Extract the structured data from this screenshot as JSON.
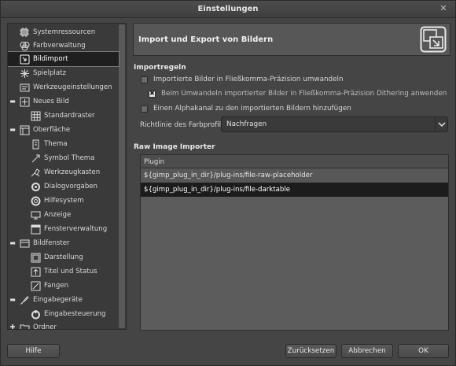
{
  "window": {
    "title": "Einstellungen",
    "close_glyph": "✕"
  },
  "sidebar": {
    "items": [
      {
        "label": "Systemressourcen",
        "icon": "chip-icon"
      },
      {
        "label": "Farbverwaltung",
        "icon": "color-management-icon"
      },
      {
        "label": "Bildimport",
        "icon": "image-import-icon",
        "selected": true
      },
      {
        "label": "Spielplatz",
        "icon": "playground-icon"
      },
      {
        "label": "Werkzeugeinstellungen",
        "icon": "tool-options-icon"
      },
      {
        "label": "Neues Bild",
        "icon": "new-image-icon",
        "expander": "minus"
      },
      {
        "label": "Standardraster",
        "icon": "grid-icon"
      },
      {
        "label": "Oberfläche",
        "icon": "interface-icon",
        "expander": "minus"
      },
      {
        "label": "Thema",
        "icon": "theme-icon"
      },
      {
        "label": "Symbol Thema",
        "icon": "icon-theme-icon"
      },
      {
        "label": "Werkzeugkasten",
        "icon": "toolbox-icon"
      },
      {
        "label": "Dialogvorgaben",
        "icon": "dialog-defaults-icon"
      },
      {
        "label": "Hilfesystem",
        "icon": "help-system-icon"
      },
      {
        "label": "Anzeige",
        "icon": "display-icon"
      },
      {
        "label": "Fensterverwaltung",
        "icon": "window-management-icon"
      },
      {
        "label": "Bildfenster",
        "icon": "image-window-icon",
        "expander": "minus"
      },
      {
        "label": "Darstellung",
        "icon": "appearance-icon"
      },
      {
        "label": "Titel und Status",
        "icon": "title-status-icon"
      },
      {
        "label": "Fangen",
        "icon": "snapping-icon"
      },
      {
        "label": "Eingabegeräte",
        "icon": "input-devices-icon",
        "expander": "minus"
      },
      {
        "label": "Eingabesteuerung",
        "icon": "input-controllers-icon"
      },
      {
        "label": "Ordner",
        "icon": "folder-icon",
        "expander": "plus"
      }
    ]
  },
  "main": {
    "header_title": "Import und Export von Bildern",
    "import_policies": {
      "title": "Importregeln",
      "opt_float": {
        "label": "Importierte Bilder in Fließkomma-Präzision umwandeln",
        "checked": false
      },
      "opt_dither": {
        "label": "Beim Umwandeln importierter Bilder in Fließkomma-Präzision Dithering anwenden",
        "checked": true,
        "glyph": "✖"
      },
      "opt_alpha": {
        "label": "Einen Alphakanal zu den importierten Bildern hinzufügen",
        "checked": false
      },
      "color_profile": {
        "label": "Richtlinie des Farbprofils:",
        "value": "Nachfragen"
      }
    },
    "raw_importer": {
      "title": "Raw Image Importer",
      "column": "Plugin",
      "rows": [
        "${gimp_plug_in_dir}/plug-ins/file-raw-placeholder",
        "${gimp_plug_in_dir}/plug-ins/file-darktable"
      ],
      "selected_row": 1
    }
  },
  "footer": {
    "help": "Hilfe",
    "reset": "Zurücksetzen",
    "cancel": "Abbrechen",
    "ok": "OK"
  },
  "colors": {
    "background": "#454545",
    "selection": "#1c1c1c",
    "header": "#575757"
  }
}
